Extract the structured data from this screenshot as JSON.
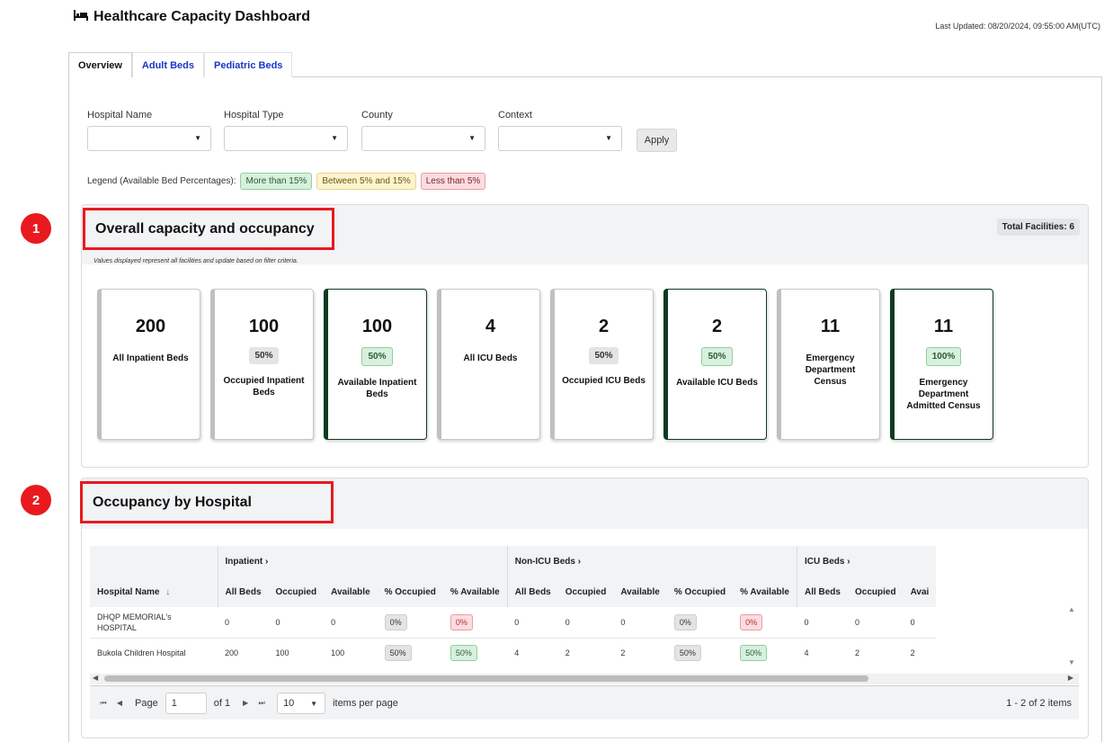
{
  "header": {
    "title": "Healthcare Capacity Dashboard",
    "last_updated": "Last Updated: 08/20/2024, 09:55:00 AM(UTC)"
  },
  "tabs": [
    {
      "label": "Overview",
      "active": true
    },
    {
      "label": "Adult Beds",
      "active": false
    },
    {
      "label": "Pediatric Beds",
      "active": false
    }
  ],
  "filters": {
    "hospital_name": {
      "label": "Hospital Name",
      "value": ""
    },
    "hospital_type": {
      "label": "Hospital Type",
      "value": ""
    },
    "county": {
      "label": "County",
      "value": ""
    },
    "context": {
      "label": "Context",
      "value": ""
    },
    "apply_label": "Apply"
  },
  "legend": {
    "label": "Legend (Available Bed Percentages):",
    "high": "More than 15%",
    "mid": "Between 5% and 15%",
    "low": "Less than 5%",
    "colors": {
      "high": "#d8f0de",
      "mid": "#fdf3cf",
      "low": "#fbdcdf"
    }
  },
  "markers": {
    "one": "1",
    "two": "2",
    "color": "#e8191f"
  },
  "capacity": {
    "title": "Overall capacity and occupancy",
    "total": "Total Facilities: 6",
    "note": "Values displayed represent all facilities and update based on filter criteria.",
    "cards": [
      {
        "value": "200",
        "pct": "",
        "label": "All Inpatient Beds"
      },
      {
        "value": "100",
        "pct": "50%",
        "label": "Occupied Inpatient Beds"
      },
      {
        "value": "100",
        "pct": "50%",
        "label": "Available Inpatient Beds"
      },
      {
        "value": "4",
        "pct": "",
        "label": "All ICU Beds"
      },
      {
        "value": "2",
        "pct": "50%",
        "label": "Occupied ICU Beds"
      },
      {
        "value": "2",
        "pct": "50%",
        "label": "Available ICU Beds"
      },
      {
        "value": "11",
        "pct": "",
        "label": "Emergency Department Census"
      },
      {
        "value": "11",
        "pct": "100%",
        "label": "Emergency Department Admitted Census"
      }
    ]
  },
  "occupancy": {
    "title": "Occupancy by Hospital",
    "groups": {
      "inpatient": "Inpatient ›",
      "non_icu": "Non-ICU Beds ›",
      "icu": "ICU Beds ›"
    },
    "columns": {
      "hospital": "Hospital Name",
      "all_beds": "All Beds",
      "occupied": "Occupied",
      "available": "Available",
      "pct_occupied": "% Occupied",
      "pct_available": "% Available",
      "icu_available_cut": "Avai"
    },
    "rows": [
      {
        "name": "DHQP MEMORIAL's HOSPITAL",
        "in_all": "0",
        "in_occ": "0",
        "in_avail": "0",
        "in_pocc": "0%",
        "in_pavail": "0%",
        "non_all": "0",
        "non_occ": "0",
        "non_avail": "0",
        "non_pocc": "0%",
        "non_pavail": "0%",
        "icu_all": "0",
        "icu_occ": "0",
        "icu_avail": "0"
      },
      {
        "name": "Bukola Children Hospital",
        "in_all": "200",
        "in_occ": "100",
        "in_avail": "100",
        "in_pocc": "50%",
        "in_pavail": "50%",
        "non_all": "4",
        "non_occ": "2",
        "non_avail": "2",
        "non_pocc": "50%",
        "non_pavail": "50%",
        "icu_all": "4",
        "icu_occ": "2",
        "icu_avail": "2"
      }
    ]
  },
  "pager": {
    "page_label": "Page",
    "page_value": "1",
    "of_label": "of 1",
    "page_size": "10",
    "items_label": "items per page",
    "range": "1 - 2 of 2 items"
  }
}
